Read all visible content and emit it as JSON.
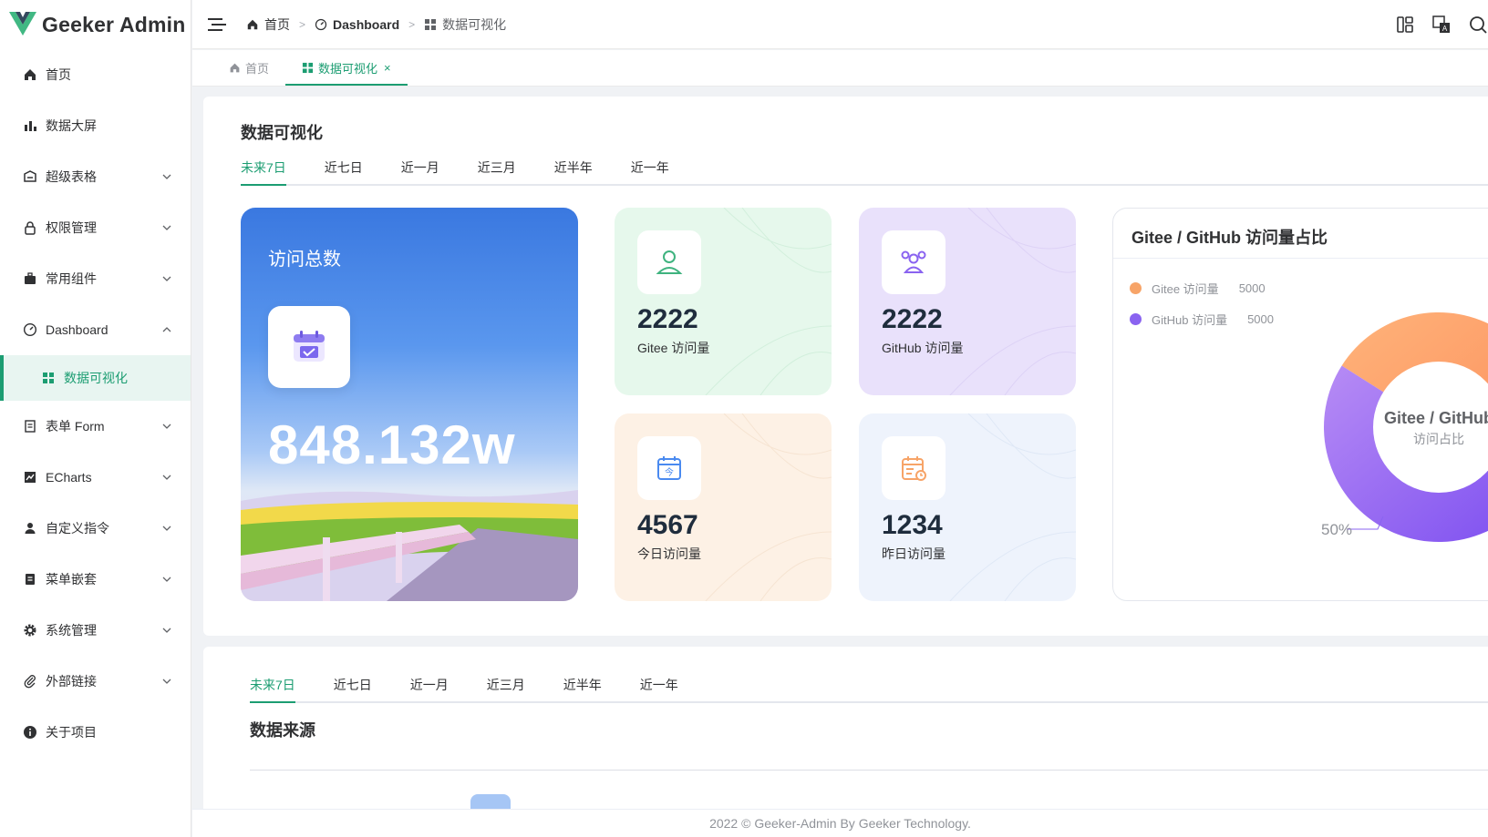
{
  "app": {
    "title": "Geeker Admin"
  },
  "sidebar": {
    "items": [
      {
        "label": "首页",
        "icon": "home-icon"
      },
      {
        "label": "数据大屏",
        "icon": "bar-chart-icon"
      },
      {
        "label": "超级表格",
        "icon": "table-icon"
      },
      {
        "label": "权限管理",
        "icon": "lock-icon"
      },
      {
        "label": "常用组件",
        "icon": "briefcase-icon"
      },
      {
        "label": "Dashboard",
        "icon": "dashboard-icon"
      },
      {
        "label": "数据可视化",
        "icon": "grid-icon"
      },
      {
        "label": "表单 Form",
        "icon": "document-icon"
      },
      {
        "label": "ECharts",
        "icon": "line-chart-icon"
      },
      {
        "label": "自定义指令",
        "icon": "user-icon"
      },
      {
        "label": "菜单嵌套",
        "icon": "list-icon"
      },
      {
        "label": "系统管理",
        "icon": "gear-icon"
      },
      {
        "label": "外部链接",
        "icon": "paperclip-icon"
      },
      {
        "label": "关于项目",
        "icon": "info-icon"
      }
    ]
  },
  "header": {
    "breadcrumb": [
      "首页",
      "Dashboard",
      "数据可视化"
    ]
  },
  "tabs": [
    {
      "label": "首页"
    },
    {
      "label": "数据可视化",
      "close": "×"
    }
  ],
  "viz": {
    "title": "数据可视化",
    "ranges": [
      "未来7日",
      "近七日",
      "近一月",
      "近三月",
      "近半年",
      "近一年"
    ],
    "total": {
      "label": "访问总数",
      "value": "848.132w"
    },
    "stats": [
      {
        "value": "2222",
        "label": "Gitee 访问量"
      },
      {
        "value": "2222",
        "label": "GitHub 访问量"
      },
      {
        "value": "4567",
        "label": "今日访问量"
      },
      {
        "value": "1234",
        "label": "昨日访问量"
      }
    ]
  },
  "chart_data": {
    "type": "pie",
    "title": "Gitee / GitHub 访问量占比",
    "center_title": "Gitee / GitHub",
    "center_subtitle": "访问占比",
    "slices": [
      {
        "name": "Gitee 访问量",
        "value": 5000,
        "color": "#f7a468"
      },
      {
        "name": "GitHub 访问量",
        "value": 5000,
        "color": "#8a63f0"
      }
    ],
    "label": "50%",
    "legend_position": "top-left"
  },
  "source": {
    "ranges": [
      "未来7日",
      "近七日",
      "近一月",
      "近三月",
      "近半年",
      "近一年"
    ],
    "title": "数据来源"
  },
  "footer": {
    "text": "2022 © Geeker-Admin By Geeker Technology."
  }
}
